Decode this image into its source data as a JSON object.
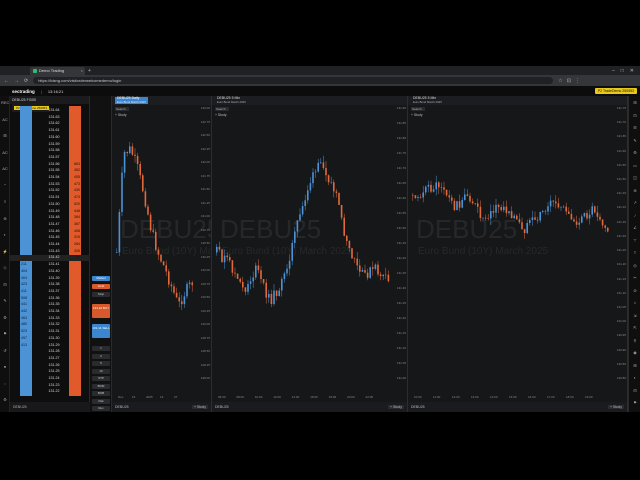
{
  "browser": {
    "tab_title": "Demo Trading",
    "new_tab": "+",
    "url": "https://tdsng.com/visitorderwelcomedemo/login",
    "window_buttons": [
      "–",
      "□",
      "✕"
    ],
    "nav": [
      "←",
      "→",
      "⟳"
    ],
    "addr_icons": [
      "☆",
      "⊡",
      "⋮"
    ]
  },
  "app": {
    "logo": "sectrading",
    "time": "13:16:21",
    "account": "P2 TradeDemo 250953"
  },
  "iconbar": {
    "items": [
      "REC",
      "AC",
      "⊞",
      "AC",
      "AC",
      "⌃",
      "≡",
      "⊕",
      "◐",
      "⚡",
      "◇",
      "⊟",
      "✎",
      "⚙",
      "⚑",
      "↺",
      "●",
      "◌",
      "⚙"
    ]
  },
  "dom": {
    "header_symbol": "DEBU25 FGBS",
    "header_sub": "Euro Schatz  March 2025",
    "account_badge": "P2 TradeDemo 250953",
    "rows": [
      {
        "bid": "",
        "price": "131.64",
        "ask": ""
      },
      {
        "bid": "",
        "price": "131.63",
        "ask": ""
      },
      {
        "bid": "",
        "price": "131.62",
        "ask": ""
      },
      {
        "bid": "",
        "price": "131.61",
        "ask": ""
      },
      {
        "bid": "",
        "price": "131.60",
        "ask": ""
      },
      {
        "bid": "",
        "price": "131.59",
        "ask": ""
      },
      {
        "bid": "",
        "price": "131.58",
        "ask": ""
      },
      {
        "bid": "",
        "price": "131.57",
        "ask": ""
      },
      {
        "bid": "",
        "price": "131.56",
        "ask": "663"
      },
      {
        "bid": "",
        "price": "131.55",
        "ask": "452"
      },
      {
        "bid": "",
        "price": "131.54",
        "ask": "405"
      },
      {
        "bid": "",
        "price": "131.53",
        "ask": "473"
      },
      {
        "bid": "",
        "price": "131.52",
        "ask": "430"
      },
      {
        "bid": "",
        "price": "131.51",
        "ask": "474"
      },
      {
        "bid": "",
        "price": "131.50",
        "ask": "520"
      },
      {
        "bid": "",
        "price": "131.49",
        "ask": "448"
      },
      {
        "bid": "",
        "price": "131.48",
        "ask": "384"
      },
      {
        "bid": "",
        "price": "131.47",
        "ask": "367"
      },
      {
        "bid": "",
        "price": "131.46",
        "ask": "408"
      },
      {
        "bid": "",
        "price": "131.45",
        "ask": "315"
      },
      {
        "bid": "",
        "price": "131.44",
        "ask": "284"
      },
      {
        "bid": "",
        "price": "131.43",
        "ask": "326"
      },
      {
        "bid": "",
        "price": "131.42",
        "ask": "97"
      },
      {
        "bid": "211",
        "price": "131.41",
        "ask": ""
      },
      {
        "bid": "404",
        "price": "131.40",
        "ask": ""
      },
      {
        "bid": "404",
        "price": "131.39",
        "ask": ""
      },
      {
        "bid": "423",
        "price": "131.38",
        "ask": ""
      },
      {
        "bid": "411",
        "price": "131.37",
        "ask": ""
      },
      {
        "bid": "508",
        "price": "131.36",
        "ask": ""
      },
      {
        "bid": "441",
        "price": "131.35",
        "ask": ""
      },
      {
        "bid": "442",
        "price": "131.34",
        "ask": ""
      },
      {
        "bid": "463",
        "price": "131.33",
        "ask": ""
      },
      {
        "bid": "480",
        "price": "131.32",
        "ask": ""
      },
      {
        "bid": "523",
        "price": "131.31",
        "ask": ""
      },
      {
        "bid": "497",
        "price": "131.30",
        "ask": ""
      },
      {
        "bid": "413",
        "price": "131.29",
        "ask": ""
      },
      {
        "bid": "",
        "price": "131.28",
        "ask": ""
      },
      {
        "bid": "",
        "price": "131.27",
        "ask": ""
      },
      {
        "bid": "",
        "price": "131.26",
        "ask": ""
      },
      {
        "bid": "",
        "price": "131.25",
        "ask": ""
      },
      {
        "bid": "",
        "price": "131.24",
        "ask": ""
      },
      {
        "bid": "",
        "price": "131.23",
        "ask": ""
      },
      {
        "bid": "",
        "price": "131.22",
        "ask": ""
      }
    ],
    "footer": "DEBU25"
  },
  "order_panel": {
    "buttons": [
      "Market",
      "Limit",
      "Stop"
    ],
    "buy_label": "131.42 BUY",
    "sell_label": "131.41 SELL",
    "qty": [
      "1",
      "2",
      "5",
      "10",
      "STP",
      "BOM",
      "BOB",
      "Flat",
      "Rev",
      "Sync"
    ]
  },
  "panes": [
    {
      "symbol": "DEBU25 Daily",
      "subtitle": "Euro Bund  March 2025",
      "search": "Search",
      "study": "+ Study",
      "watermark_symbol": "DEBU25",
      "watermark_name": "Euro Bund (10Y)  March 2025",
      "yticks": [
        "133.00",
        "132.75",
        "132.50",
        "132.25",
        "132.00",
        "131.75",
        "131.50",
        "131.25",
        "131.00",
        "130.75",
        "130.50",
        "130.25",
        "130.00",
        "129.75",
        "129.50",
        "129.25",
        "129.00",
        "128.75",
        "128.50",
        "128.25",
        "128.00"
      ],
      "xticks": [
        "Dec",
        "16",
        "2025",
        "13",
        "27"
      ],
      "footer": "DEBU25",
      "footer_study": "+ Study"
    },
    {
      "symbol": "DEBU25 5 Min",
      "subtitle": "Euro Bund  March 2025",
      "search": "Search",
      "study": "+ Study",
      "watermark_symbol": "DEBU25",
      "watermark_name": "Euro Bund (10Y)  March 2025",
      "yticks": [
        "131.90",
        "131.85",
        "131.80",
        "131.75",
        "131.70",
        "131.65",
        "131.60",
        "131.55",
        "131.50",
        "131.45",
        "131.40",
        "131.35",
        "131.30",
        "131.25",
        "131.20",
        "131.15",
        "131.10",
        "131.05",
        "131.00"
      ],
      "xticks": [
        "06:00",
        "08:00",
        "10:00",
        "12:00",
        "14:00",
        "16:00",
        "18:00",
        "20:00",
        "22:00"
      ],
      "footer": "DEBU25",
      "footer_study": "+ Study"
    },
    {
      "symbol": "DEBU25 5 Min",
      "subtitle": "Euro Bund  March 2025",
      "search": "Search",
      "study": "+ Study",
      "watermark_symbol": "DEBU25",
      "watermark_name": "Euro Bund (10Y)  March 2025",
      "yticks": [
        "131.75",
        "131.70",
        "131.65",
        "131.60",
        "131.55",
        "131.50",
        "131.45",
        "131.40",
        "131.35",
        "131.30",
        "131.25",
        "131.20",
        "131.15",
        "131.10",
        "131.05",
        "131.00",
        "130.95",
        "130.90",
        "130.85",
        "130.80"
      ],
      "xticks": [
        "10:00",
        "11:00",
        "12:00",
        "13:00",
        "14:00",
        "15:00",
        "16:00",
        "17:00",
        "18:00",
        "19:00"
      ],
      "footer": "DEBU25",
      "footer_study": "+ Study"
    }
  ],
  "rbar": {
    "items": [
      "⊞",
      "⊡",
      "☰",
      "✎",
      "⚙",
      "▭",
      "◫",
      "⊕",
      "↗",
      "/",
      "∠",
      "⊤",
      "T",
      "◎",
      "✂",
      "⊘",
      "⌂",
      "⇲",
      "⇱",
      "⚲",
      "◉",
      "⊞",
      "◐",
      "⊟",
      "⚑"
    ]
  },
  "colors": {
    "bull": "#4c93d6",
    "bear": "#e06a3b",
    "accent": "#3a87d0"
  }
}
